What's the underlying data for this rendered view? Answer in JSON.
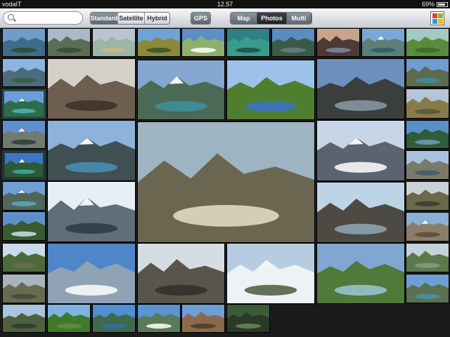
{
  "status": {
    "carrier": "vodaIT",
    "time": "12.57",
    "battery_text": "69%",
    "battery_level": 0.69
  },
  "toolbar": {
    "search_placeholder": "",
    "map_types": [
      {
        "label": "Standard",
        "selected": true
      },
      {
        "label": "Satellite",
        "selected": false
      },
      {
        "label": "Hybrid",
        "selected": false
      }
    ],
    "gps_label": "GPS",
    "views": [
      {
        "label": "Map",
        "selected": false
      },
      {
        "label": "Photos",
        "selected": true
      },
      {
        "label": "Multi",
        "selected": false
      }
    ]
  },
  "photos": [
    {
      "name": "photo-lake-trees",
      "sky": "#6f9cc9",
      "land": "#3d6b8a",
      "accent": "#2c4a2a",
      "snow": false
    },
    {
      "name": "photo-lake-forest",
      "sky": "#a9b9c7",
      "land": "#5a6e55",
      "accent": "#3a4a33",
      "snow": false
    },
    {
      "name": "photo-rainbow",
      "sky": "#b8c4cf",
      "land": "#9db5a5",
      "accent": "#c5b98a",
      "snow": false
    },
    {
      "name": "photo-meadow-tree",
      "sky": "#6fa3d8",
      "land": "#8a8a3a",
      "accent": "#3c4f2b",
      "snow": false
    },
    {
      "name": "photo-road-clouds",
      "sky": "#5c8fc8",
      "land": "#8fb06a",
      "accent": "#ffffff",
      "snow": false
    },
    {
      "name": "photo-teal-river",
      "sky": "#2f7f86",
      "land": "#3a9a8c",
      "accent": "#1c4f4a",
      "snow": false
    },
    {
      "name": "photo-valley-blue",
      "sky": "#5a8dc2",
      "land": "#3b5a46",
      "accent": "#6b7d86",
      "snow": false
    },
    {
      "name": "photo-sunset-ridge",
      "sky": "#c8a58a",
      "land": "#4d3a36",
      "accent": "#7a8aa6",
      "snow": false
    },
    {
      "name": "photo-snow-lake",
      "sky": "#7aa8d6",
      "land": "#5e7f78",
      "accent": "#2d5c66",
      "snow": true
    },
    {
      "name": "photo-green-slope",
      "sky": "#a2c9c2",
      "land": "#5c8a3a",
      "accent": "#3a6a2a",
      "snow": false
    },
    {
      "name": "photo-clouds-lake",
      "sky": "#8ab5e4",
      "land": "#4d6b7a",
      "accent": "#3a5a42",
      "snow": false
    },
    {
      "name": "photo-rock-wall",
      "sky": "#d5d0c8",
      "land": "#6e5e4f",
      "accent": "#3b3129",
      "snow": false
    },
    {
      "name": "photo-turquoise-lake",
      "sky": "#6b9ed6",
      "land": "#2f6c4a",
      "accent": "#4fb8b0",
      "snow": true
    },
    {
      "name": "photo-rocky-peaks",
      "sky": "#7fb2e6",
      "land": "#6a5a3a",
      "accent": "#3fa8a6",
      "snow": true
    },
    {
      "name": "photo-alpine-lake",
      "sky": "#6f9dd0",
      "land": "#5e6a4e",
      "accent": "#3a8fa0",
      "snow": false
    },
    {
      "name": "photo-snow-peaks-small",
      "sky": "#5f8fd0",
      "land": "#707a70",
      "accent": "#2d3d33",
      "snow": true
    },
    {
      "name": "photo-peak-lake-small",
      "sky": "#8eb3da",
      "land": "#3f4f52",
      "accent": "#4a8fb6",
      "snow": true
    },
    {
      "name": "photo-featured-lake",
      "sky": "#3f74c0",
      "land": "#2d5a34",
      "accent": "#3faeaa",
      "snow": true
    },
    {
      "name": "photo-mountain-lake",
      "sky": "#86a7cf",
      "land": "#4a6a56",
      "accent": "#3f8f9c",
      "snow": true
    },
    {
      "name": "photo-green-valley-tent",
      "sky": "#9cc2ea",
      "land": "#4f7f2e",
      "accent": "#3b72c4",
      "snow": false
    },
    {
      "name": "photo-dark-ridge",
      "sky": "#6d8fbd",
      "land": "#3b3f3c",
      "accent": "#8b9aa8",
      "snow": false
    },
    {
      "name": "photo-autumn-hill",
      "sky": "#b3c6d8",
      "land": "#8a7a4a",
      "accent": "#4d5a3a",
      "snow": false
    },
    {
      "name": "photo-snow-ridge",
      "sky": "#c6d6e6",
      "land": "#5a6470",
      "accent": "#ffffff",
      "snow": true
    },
    {
      "name": "photo-lake-pines",
      "sky": "#5b8fc9",
      "land": "#2f5c3a",
      "accent": "#6a9fb8",
      "snow": false
    },
    {
      "name": "photo-van-road",
      "sky": "#9fb4c3",
      "land": "#6a6650",
      "accent": "#e8e0c8",
      "snow": false
    },
    {
      "name": "photo-rocks-water",
      "sky": "#a8c2de",
      "land": "#7a7a6a",
      "accent": "#3f5a66",
      "snow": false
    },
    {
      "name": "photo-glacier-lake",
      "sky": "#6ea0d6",
      "land": "#51665a",
      "accent": "#61a8bc",
      "snow": true
    },
    {
      "name": "photo-snow-cliffs",
      "sky": "#e6eef6",
      "land": "#5f6e78",
      "accent": "#2d3a44",
      "snow": true
    },
    {
      "name": "photo-sea-rocks",
      "sky": "#bdd4e6",
      "land": "#4d4a44",
      "accent": "#8fa7b8",
      "snow": false
    },
    {
      "name": "photo-dead-trees",
      "sky": "#c9d1d6",
      "land": "#6a6a4a",
      "accent": "#3a3a2a",
      "snow": false
    },
    {
      "name": "photo-mountain-stream",
      "sky": "#5e90c8",
      "land": "#3a5a32",
      "accent": "#cfe0ec",
      "snow": false
    },
    {
      "name": "photo-scree-hiker",
      "sky": "#8ab0d8",
      "land": "#8a7e6a",
      "accent": "#5a4a3a",
      "snow": true
    },
    {
      "name": "photo-green-peaks",
      "sky": "#c9dcec",
      "land": "#4d6a3a",
      "accent": "#6a6a5a",
      "snow": false
    },
    {
      "name": "photo-frozen-lake",
      "sky": "#4f86c9",
      "land": "#8fa3b4",
      "accent": "#ffffff",
      "snow": false
    },
    {
      "name": "photo-rock-pile",
      "sky": "#d6dde2",
      "land": "#5a554a",
      "accent": "#2f2f2a",
      "snow": false
    },
    {
      "name": "photo-snow-slope",
      "sky": "#b7cce0",
      "land": "#eef2f4",
      "accent": "#4a5a40",
      "snow": true
    },
    {
      "name": "photo-winding-river",
      "sky": "#7fa7d0",
      "land": "#4f7a3a",
      "accent": "#9ec6d6",
      "snow": false
    },
    {
      "name": "photo-hazy-valley",
      "sky": "#c6d2db",
      "land": "#5a7a4a",
      "accent": "#8a9a8a",
      "snow": false
    },
    {
      "name": "photo-hills-fog",
      "sky": "#a8b5bf",
      "land": "#6a6a50",
      "accent": "#3a4a3a",
      "snow": false
    },
    {
      "name": "photo-lake-shore",
      "sky": "#6f9fd2",
      "land": "#5a7050",
      "accent": "#4d8fa6",
      "snow": false
    },
    {
      "name": "photo-wide-valley",
      "sky": "#a8c4de",
      "land": "#4d6040",
      "accent": "#2c3a2a",
      "snow": false
    },
    {
      "name": "photo-green-meadow",
      "sky": "#7fb3e4",
      "land": "#3f7a2a",
      "accent": "#6a8a4a",
      "snow": false
    },
    {
      "name": "photo-blue-lake",
      "sky": "#4f8fd6",
      "land": "#3f6a4a",
      "accent": "#2f6fa8",
      "snow": false
    },
    {
      "name": "photo-cloud-lake",
      "sky": "#5a94d2",
      "land": "#5a7a5a",
      "accent": "#ffffff",
      "snow": false
    },
    {
      "name": "photo-brown-peaks",
      "sky": "#6f9ed6",
      "land": "#8a6a4a",
      "accent": "#4a3a2a",
      "snow": false
    },
    {
      "name": "photo-dark-forest",
      "sky": "#3a5a3a",
      "land": "#2a3a26",
      "accent": "#6a8a5a",
      "snow": false
    }
  ]
}
